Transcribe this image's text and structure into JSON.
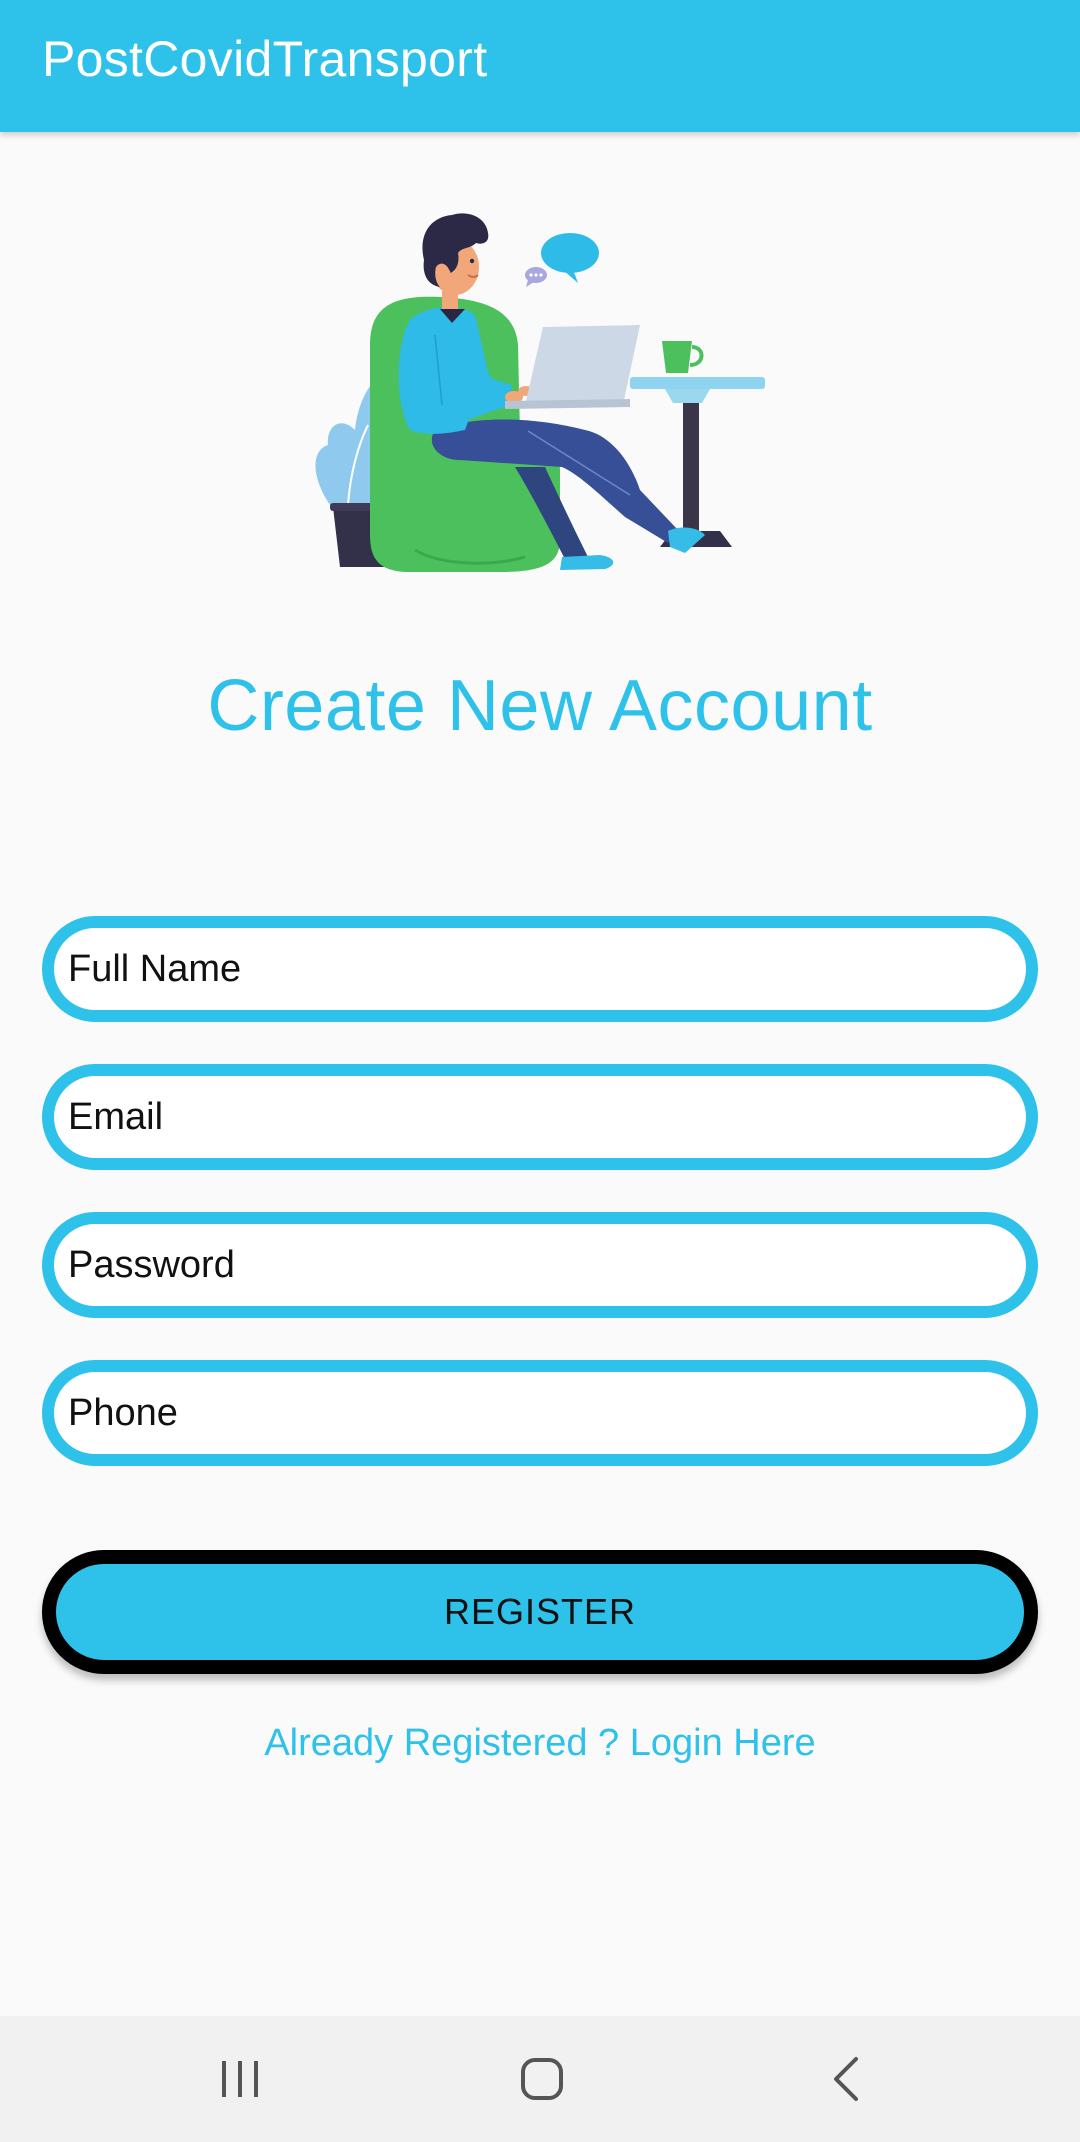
{
  "app_bar": {
    "title": "PostCovidTransport"
  },
  "main": {
    "headline": "Create New Account",
    "fields": {
      "full_name": {
        "placeholder": "Full Name",
        "value": ""
      },
      "email": {
        "placeholder": "Email",
        "value": ""
      },
      "password": {
        "placeholder": "Password",
        "value": ""
      },
      "phone": {
        "placeholder": "Phone",
        "value": ""
      }
    },
    "register_label": "REGISTER",
    "login_link": "Already Registered ? Login Here"
  },
  "illustration": {
    "icon": "person-with-laptop-illustration"
  },
  "nav_bar": {
    "icons": [
      "recent-apps-icon",
      "home-icon",
      "back-icon"
    ]
  },
  "colors": {
    "accent": "#2ec2ea",
    "background": "#fafafa",
    "button_border": "#000000",
    "nav_bar": "#f1f1f1"
  }
}
